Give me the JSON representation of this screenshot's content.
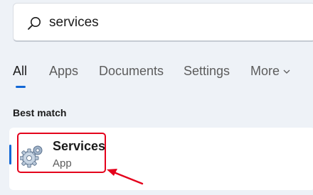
{
  "search": {
    "value": "services",
    "icon": "search-icon"
  },
  "tabs": [
    {
      "label": "All",
      "active": true
    },
    {
      "label": "Apps"
    },
    {
      "label": "Documents"
    },
    {
      "label": "Settings"
    },
    {
      "label": "More"
    }
  ],
  "best_match": {
    "label": "Best match",
    "result": {
      "title": "Services",
      "subtitle": "App",
      "icon": "gears-icon"
    }
  },
  "colors": {
    "accent": "#1167d6",
    "annotation": "#e4001b"
  }
}
